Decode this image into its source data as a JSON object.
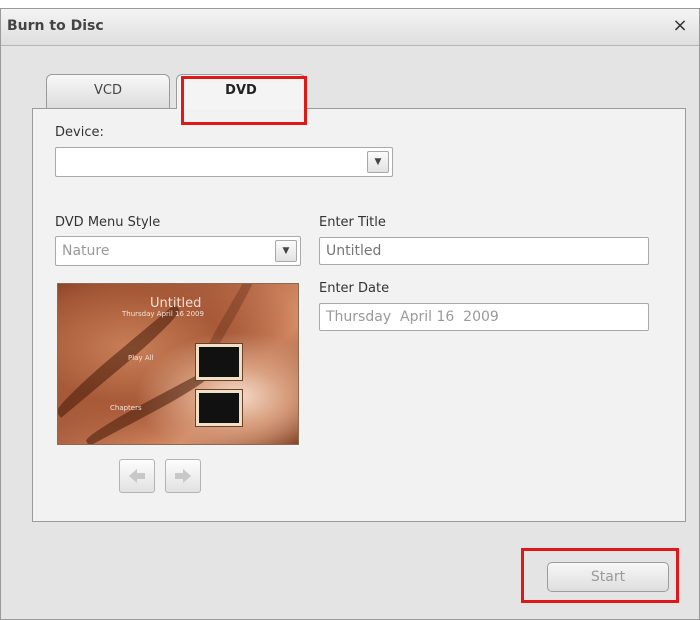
{
  "window": {
    "title": "Burn to Disc",
    "close_label": "×"
  },
  "tabs": [
    {
      "label": "VCD",
      "active": false
    },
    {
      "label": "DVD",
      "active": true
    }
  ],
  "device": {
    "label": "Device:",
    "value": ""
  },
  "menu_style": {
    "label": "DVD Menu Style",
    "value": "Nature"
  },
  "title_field": {
    "label": "Enter Title",
    "placeholder": "Untitled"
  },
  "date_field": {
    "label": "Enter Date",
    "value": "Thursday  April 16  2009"
  },
  "preview": {
    "title": "Untitled",
    "date": "Thursday April 16 2009",
    "play_all": "Play All",
    "chapters": "Chapters"
  },
  "footer": {
    "start_label": "Start"
  },
  "colors": {
    "highlight": "#e01818",
    "dialog_bg": "#e4e4e4",
    "panel_bg": "#f2f2f2"
  },
  "icons": {
    "close": "close-icon",
    "dropdown": "chevron-down-icon",
    "prev": "arrow-left-icon",
    "next": "arrow-right-icon"
  }
}
